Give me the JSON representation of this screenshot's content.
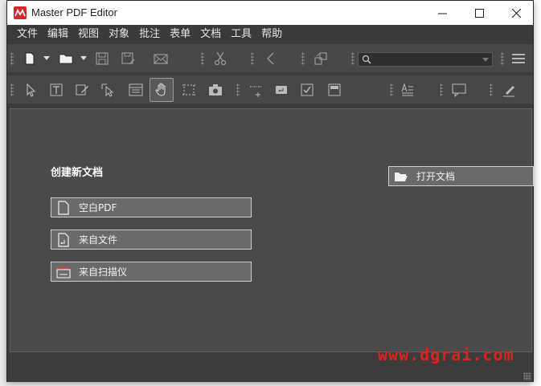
{
  "window": {
    "title": "Master PDF Editor"
  },
  "menu": [
    "文件",
    "编辑",
    "视图",
    "对象",
    "批注",
    "表单",
    "文档",
    "工具",
    "帮助"
  ],
  "search": {
    "placeholder": ""
  },
  "start": {
    "create_title": "创建新文档",
    "blank_pdf": "空白PDF",
    "from_file": "来自文件",
    "from_scanner": "来自扫描仪",
    "open_document": "打开文档"
  },
  "watermark": "www.dgrai.com",
  "colors": {
    "accent_red": "#d6282b",
    "panel": "#4a4a4a",
    "toolbar": "#474747"
  }
}
